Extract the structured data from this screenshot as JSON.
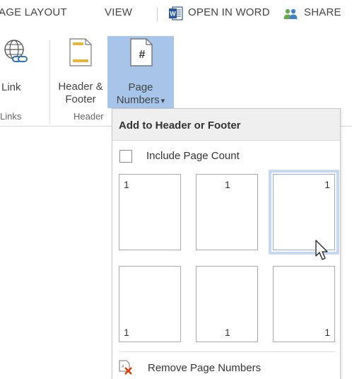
{
  "tabs": {
    "page_layout": "AGE LAYOUT",
    "view": "VIEW",
    "open_in_word": "OPEN IN WORD",
    "share": "SHARE"
  },
  "ribbon": {
    "link": {
      "label": "Link",
      "icon": "link-globe-icon"
    },
    "header_footer": {
      "line1": "Header &",
      "line2": "Footer",
      "icon": "header-footer-icon"
    },
    "page_numbers": {
      "line1": "Page",
      "line2": "Numbers",
      "caret": "▾",
      "icon": "page-number-icon",
      "glyph": "#"
    },
    "groups": {
      "links": "Links",
      "header": "Header"
    }
  },
  "dropdown": {
    "title": "Add to Header or Footer",
    "include_page_count": {
      "label": "Include Page Count",
      "checked": false
    },
    "thumbnails": [
      {
        "position": "top-left",
        "number": "1"
      },
      {
        "position": "top-center",
        "number": "1"
      },
      {
        "position": "top-right",
        "number": "1",
        "selected": true
      },
      {
        "position": "bottom-left",
        "number": "1"
      },
      {
        "position": "bottom-center",
        "number": "1"
      },
      {
        "position": "bottom-right",
        "number": "1"
      }
    ],
    "remove_label": "Remove Page Numbers"
  },
  "colors": {
    "active_button": "#a7c5e8",
    "selected_outline": "#c6d7ee",
    "word_blue": "#2b579a",
    "remove_red": "#d83b01"
  }
}
